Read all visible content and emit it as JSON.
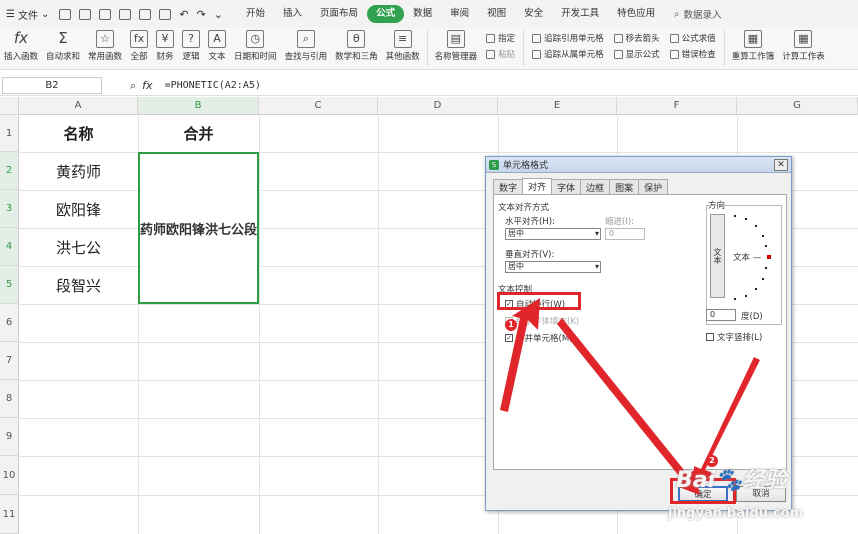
{
  "menubar": {
    "file_label": "文件",
    "tabs": [
      "开始",
      "插入",
      "页面布局",
      "公式",
      "数据",
      "审阅",
      "视图",
      "安全",
      "开发工具",
      "特色应用"
    ],
    "active_tab": "公式",
    "search_label": "数据录入"
  },
  "ribbon": {
    "insert_function": "插入函数",
    "autosum": "自动求和",
    "common": "常用函数",
    "all": "全部",
    "finance": "财务",
    "logic": "逻辑",
    "text": "文本",
    "datetime": "日期和时间",
    "lookup": "查找与引用",
    "math": "数学和三角",
    "other": "其他函数",
    "name_manager": "名称管理器",
    "specify": "指定",
    "paste": "粘贴",
    "trace_precedents": "追踪引用单元格",
    "trace_dependents": "追踪从属单元格",
    "remove_arrows": "移去箭头",
    "show_formula": "显示公式",
    "evaluate": "公式求值",
    "error_check": "错误检查",
    "recalc_book": "重算工作簿",
    "calc_sheet": "计算工作表"
  },
  "formula_bar": {
    "name_box": "B2",
    "fx_label": "fx",
    "formula": "=PHONETIC(A2:A5)"
  },
  "sheet": {
    "columns": [
      "A",
      "B",
      "C",
      "D",
      "E",
      "F",
      "G"
    ],
    "rows": [
      "1",
      "2",
      "3",
      "4",
      "5",
      "6",
      "7",
      "8",
      "9",
      "10",
      "11"
    ],
    "header_a": "名称",
    "header_b": "合并",
    "names": [
      "黄药师",
      "欧阳锋",
      "洪七公",
      "段智兴"
    ],
    "merged_text": "药师欧阳锋洪七公段"
  },
  "dialog": {
    "title": "单元格格式",
    "tabs": [
      "数字",
      "对齐",
      "字体",
      "边框",
      "图案",
      "保护"
    ],
    "active_tab": "对齐",
    "align_section": "文本对齐方式",
    "horizontal_label": "水平对齐(H):",
    "horizontal_value": "居中",
    "indent_label": "缩进(I):",
    "indent_value": "0",
    "vertical_label": "垂直对齐(V):",
    "vertical_value": "居中",
    "control_section": "文本控制",
    "wrap_text": "自动换行(W)",
    "shrink_fit": "缩小字体填充(K)",
    "merge_cells": "合并单元格(M)",
    "orientation_label": "方向",
    "orient_vertical": "文本",
    "orient_text": "文本 —",
    "degree_value": "0",
    "degree_label": "度(D)",
    "vertical_text": "文字竖排(L)",
    "ok": "确定",
    "cancel": "取消"
  },
  "annotations": {
    "badge1": "1",
    "badge2": "2",
    "accent": "#e0262b"
  },
  "watermark": {
    "brand": "Bai",
    "brand_cn": "经验",
    "url": "jingyan.baidu.com"
  }
}
